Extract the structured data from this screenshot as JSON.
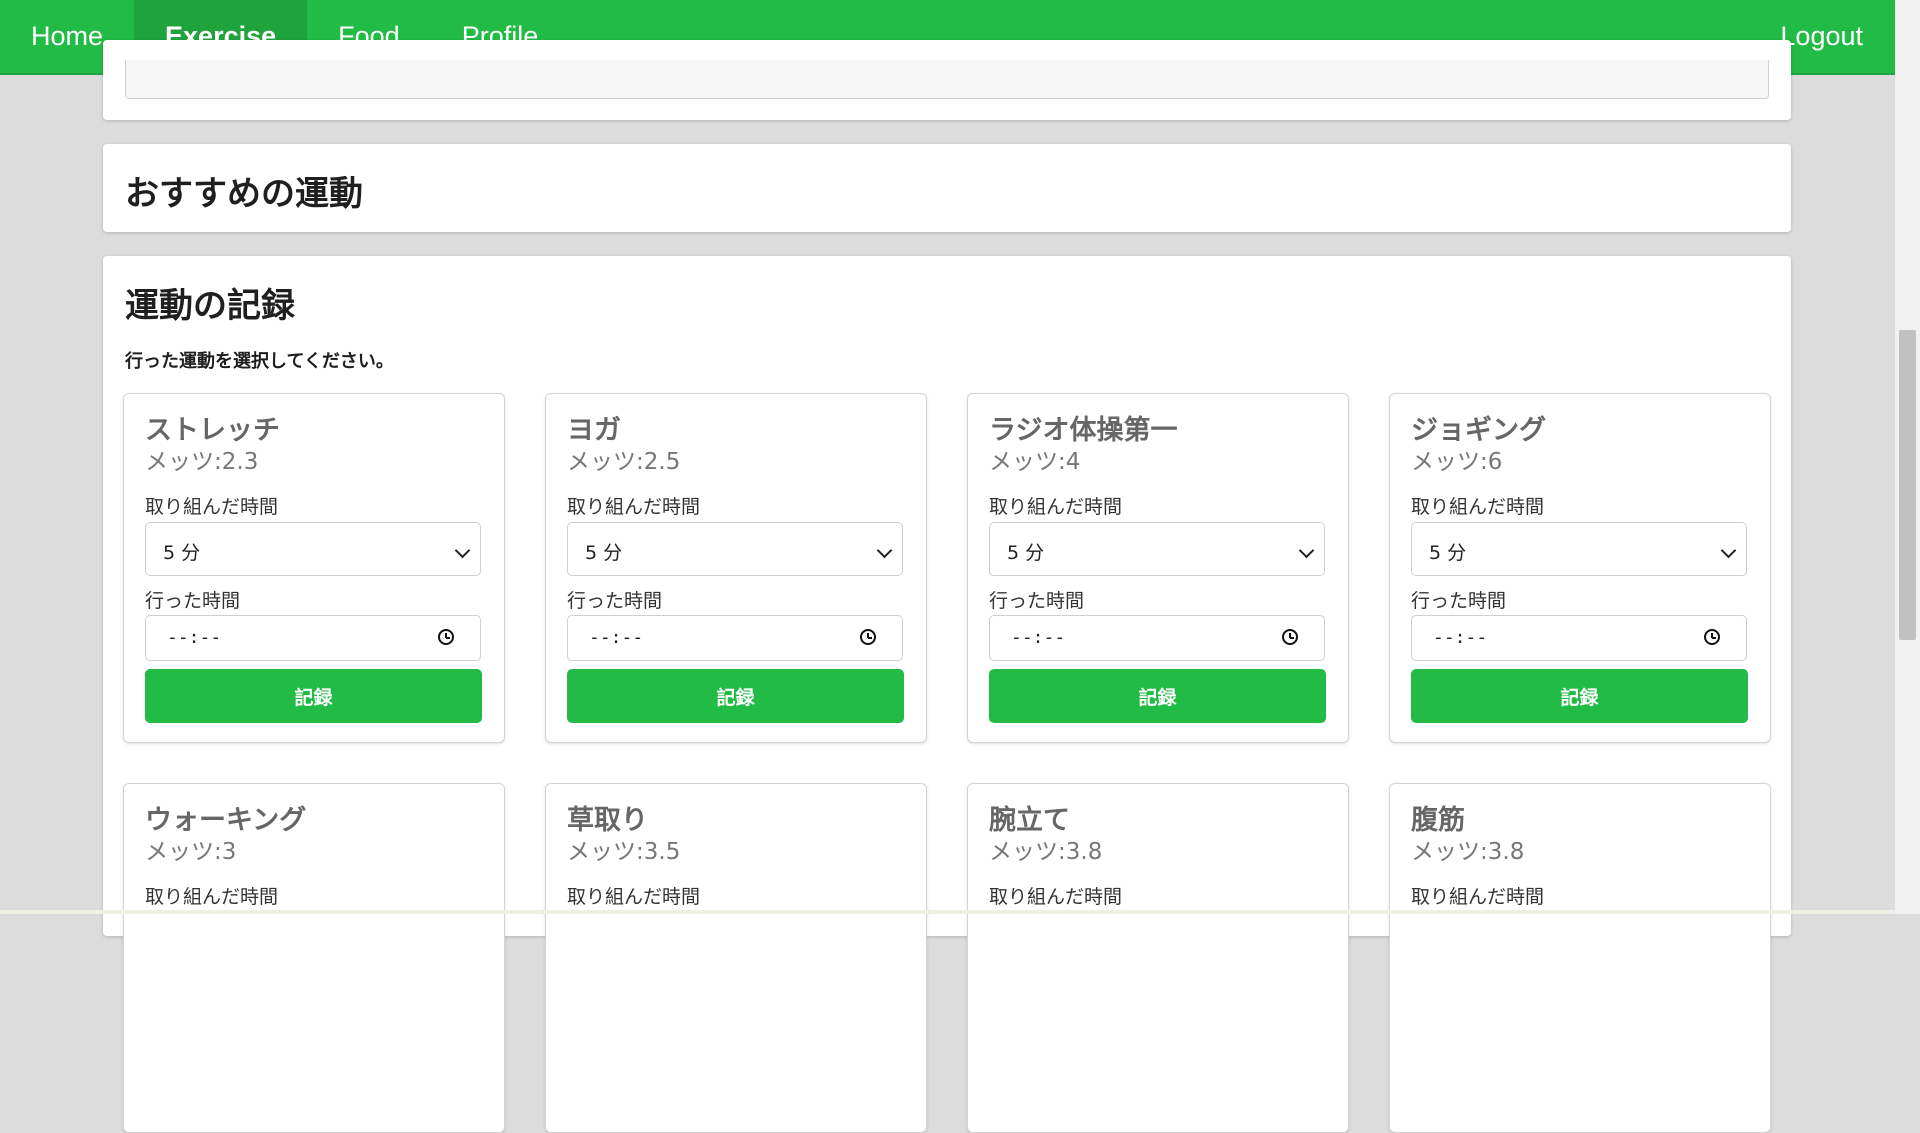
{
  "nav": {
    "items": [
      {
        "label": "Home",
        "active": false
      },
      {
        "label": "Exercise",
        "active": true
      },
      {
        "label": "Food",
        "active": false
      },
      {
        "label": "Profile",
        "active": false
      }
    ],
    "logout": "Logout"
  },
  "recommend": {
    "title": "おすすめの運動"
  },
  "log": {
    "title": "運動の記録",
    "instruction": "行った運動を選択してください。"
  },
  "card_labels": {
    "duration_label": "取り組んだ時間",
    "time_label": "行った時間",
    "duration_value": "5 分",
    "time_value": "--:--",
    "button": "記録"
  },
  "exercises": [
    {
      "name": "ストレッチ",
      "mets": "メッツ:2.3"
    },
    {
      "name": "ヨガ",
      "mets": "メッツ:2.5"
    },
    {
      "name": "ラジオ体操第一",
      "mets": "メッツ:4"
    },
    {
      "name": "ジョギング",
      "mets": "メッツ:6"
    },
    {
      "name": "ウォーキング",
      "mets": "メッツ:3"
    },
    {
      "name": "草取り",
      "mets": "メッツ:3.5"
    },
    {
      "name": "腕立て",
      "mets": "メッツ:3.8"
    },
    {
      "name": "腹筋",
      "mets": "メッツ:3.8"
    }
  ],
  "colors": {
    "accent": "#22bb45",
    "background": "#dcdcdc"
  }
}
